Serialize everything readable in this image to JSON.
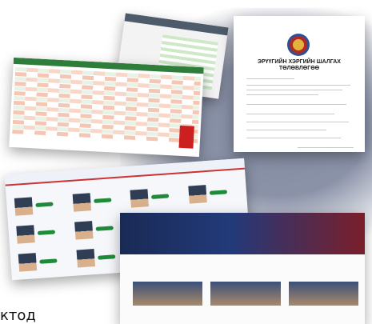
{
  "document": {
    "title_line1": "ЭРҮҮГИЙН ХЭРГИЙН ШАЛГАХ",
    "title_line2": "ТӨЛӨВЛӨГӨӨ"
  },
  "caption": "ктод",
  "colors": {
    "sheet_header": "#2f7d3a",
    "highlight_red": "#cc1f1f",
    "staff_button": "#1f8b3a",
    "site_navy": "#1a2a55"
  }
}
